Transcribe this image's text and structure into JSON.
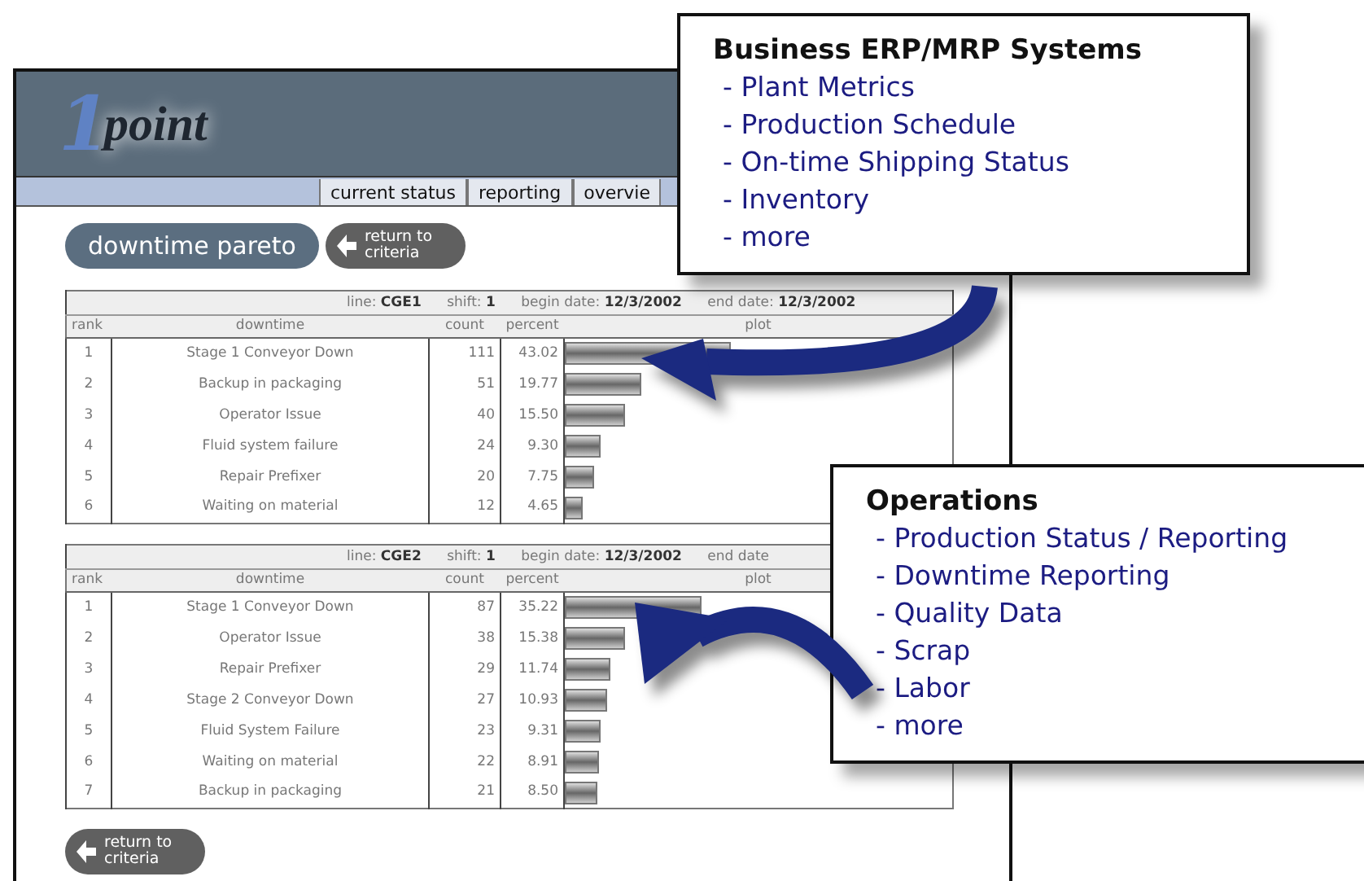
{
  "app": {
    "logo": {
      "numeral": "1",
      "word": "point"
    },
    "nav_tabs": [
      {
        "label": "current status"
      },
      {
        "label": "reporting"
      },
      {
        "label": "overvie"
      }
    ],
    "title_button": "downtime pareto",
    "top_return_button": "return to criteria",
    "tables": [
      {
        "info": [
          {
            "label": "line:",
            "value": "CGE1"
          },
          {
            "label": "shift:",
            "value": "1"
          },
          {
            "label": "begin date:",
            "value": "12/3/2002"
          },
          {
            "label": "end date:",
            "value": "12/3/2002"
          }
        ],
        "columns": [
          "rank",
          "downtime",
          "count",
          "percent",
          "plot"
        ],
        "rows": [
          {
            "rank": "1",
            "downtime": "Stage 1 Conveyor Down",
            "count": "111",
            "percent": "43.02",
            "level": 0.4302
          },
          {
            "rank": "2",
            "downtime": "Backup in packaging",
            "count": "51",
            "percent": "19.77",
            "level": 0.1977
          },
          {
            "rank": "3",
            "downtime": "Operator Issue",
            "count": "40",
            "percent": "15.50",
            "level": 0.155
          },
          {
            "rank": "4",
            "downtime": "Fluid system failure",
            "count": "24",
            "percent": "9.30",
            "level": 0.093
          },
          {
            "rank": "5",
            "downtime": "Repair Prefixer",
            "count": "20",
            "percent": "7.75",
            "level": 0.0775
          },
          {
            "rank": "6",
            "downtime": "Waiting on material",
            "count": "12",
            "percent": "4.65",
            "level": 0.0465
          }
        ]
      },
      {
        "info": [
          {
            "label": "line:",
            "value": "CGE2"
          },
          {
            "label": "shift:",
            "value": "1"
          },
          {
            "label": "begin date:",
            "value": "12/3/2002"
          },
          {
            "label": "end date"
          }
        ],
        "columns": [
          "rank",
          "downtime",
          "count",
          "percent",
          "plot"
        ],
        "rows": [
          {
            "rank": "1",
            "downtime": "Stage 1 Conveyor Down",
            "count": "87",
            "percent": "35.22",
            "level": 0.3522
          },
          {
            "rank": "2",
            "downtime": "Operator Issue",
            "count": "38",
            "percent": "15.38",
            "level": 0.1538
          },
          {
            "rank": "3",
            "downtime": "Repair Prefixer",
            "count": "29",
            "percent": "11.74",
            "level": 0.1174
          },
          {
            "rank": "4",
            "downtime": "Stage 2 Conveyor Down",
            "count": "27",
            "percent": "10.93",
            "level": 0.1093
          },
          {
            "rank": "5",
            "downtime": "Fluid System Failure",
            "count": "23",
            "percent": "9.31",
            "level": 0.0931
          },
          {
            "rank": "6",
            "downtime": "Waiting on material",
            "count": "22",
            "percent": "8.91",
            "level": 0.0891
          },
          {
            "rank": "7",
            "downtime": "Backup in packaging",
            "count": "21",
            "percent": "8.50",
            "level": 0.085
          }
        ]
      }
    ],
    "bottom_return_button": "return to criteria"
  },
  "callouts": [
    {
      "title": "Business ERP/MRP Systems",
      "items": [
        "- Plant Metrics",
        "- Production Schedule",
        "- On-time Shipping Status",
        "- Inventory",
        "- more"
      ]
    },
    {
      "title": "Operations",
      "items": [
        "- Production Status / Reporting",
        "- Downtime Reporting",
        "- Quality Data",
        "- Scrap",
        "- Labor",
        "- more"
      ]
    }
  ]
}
